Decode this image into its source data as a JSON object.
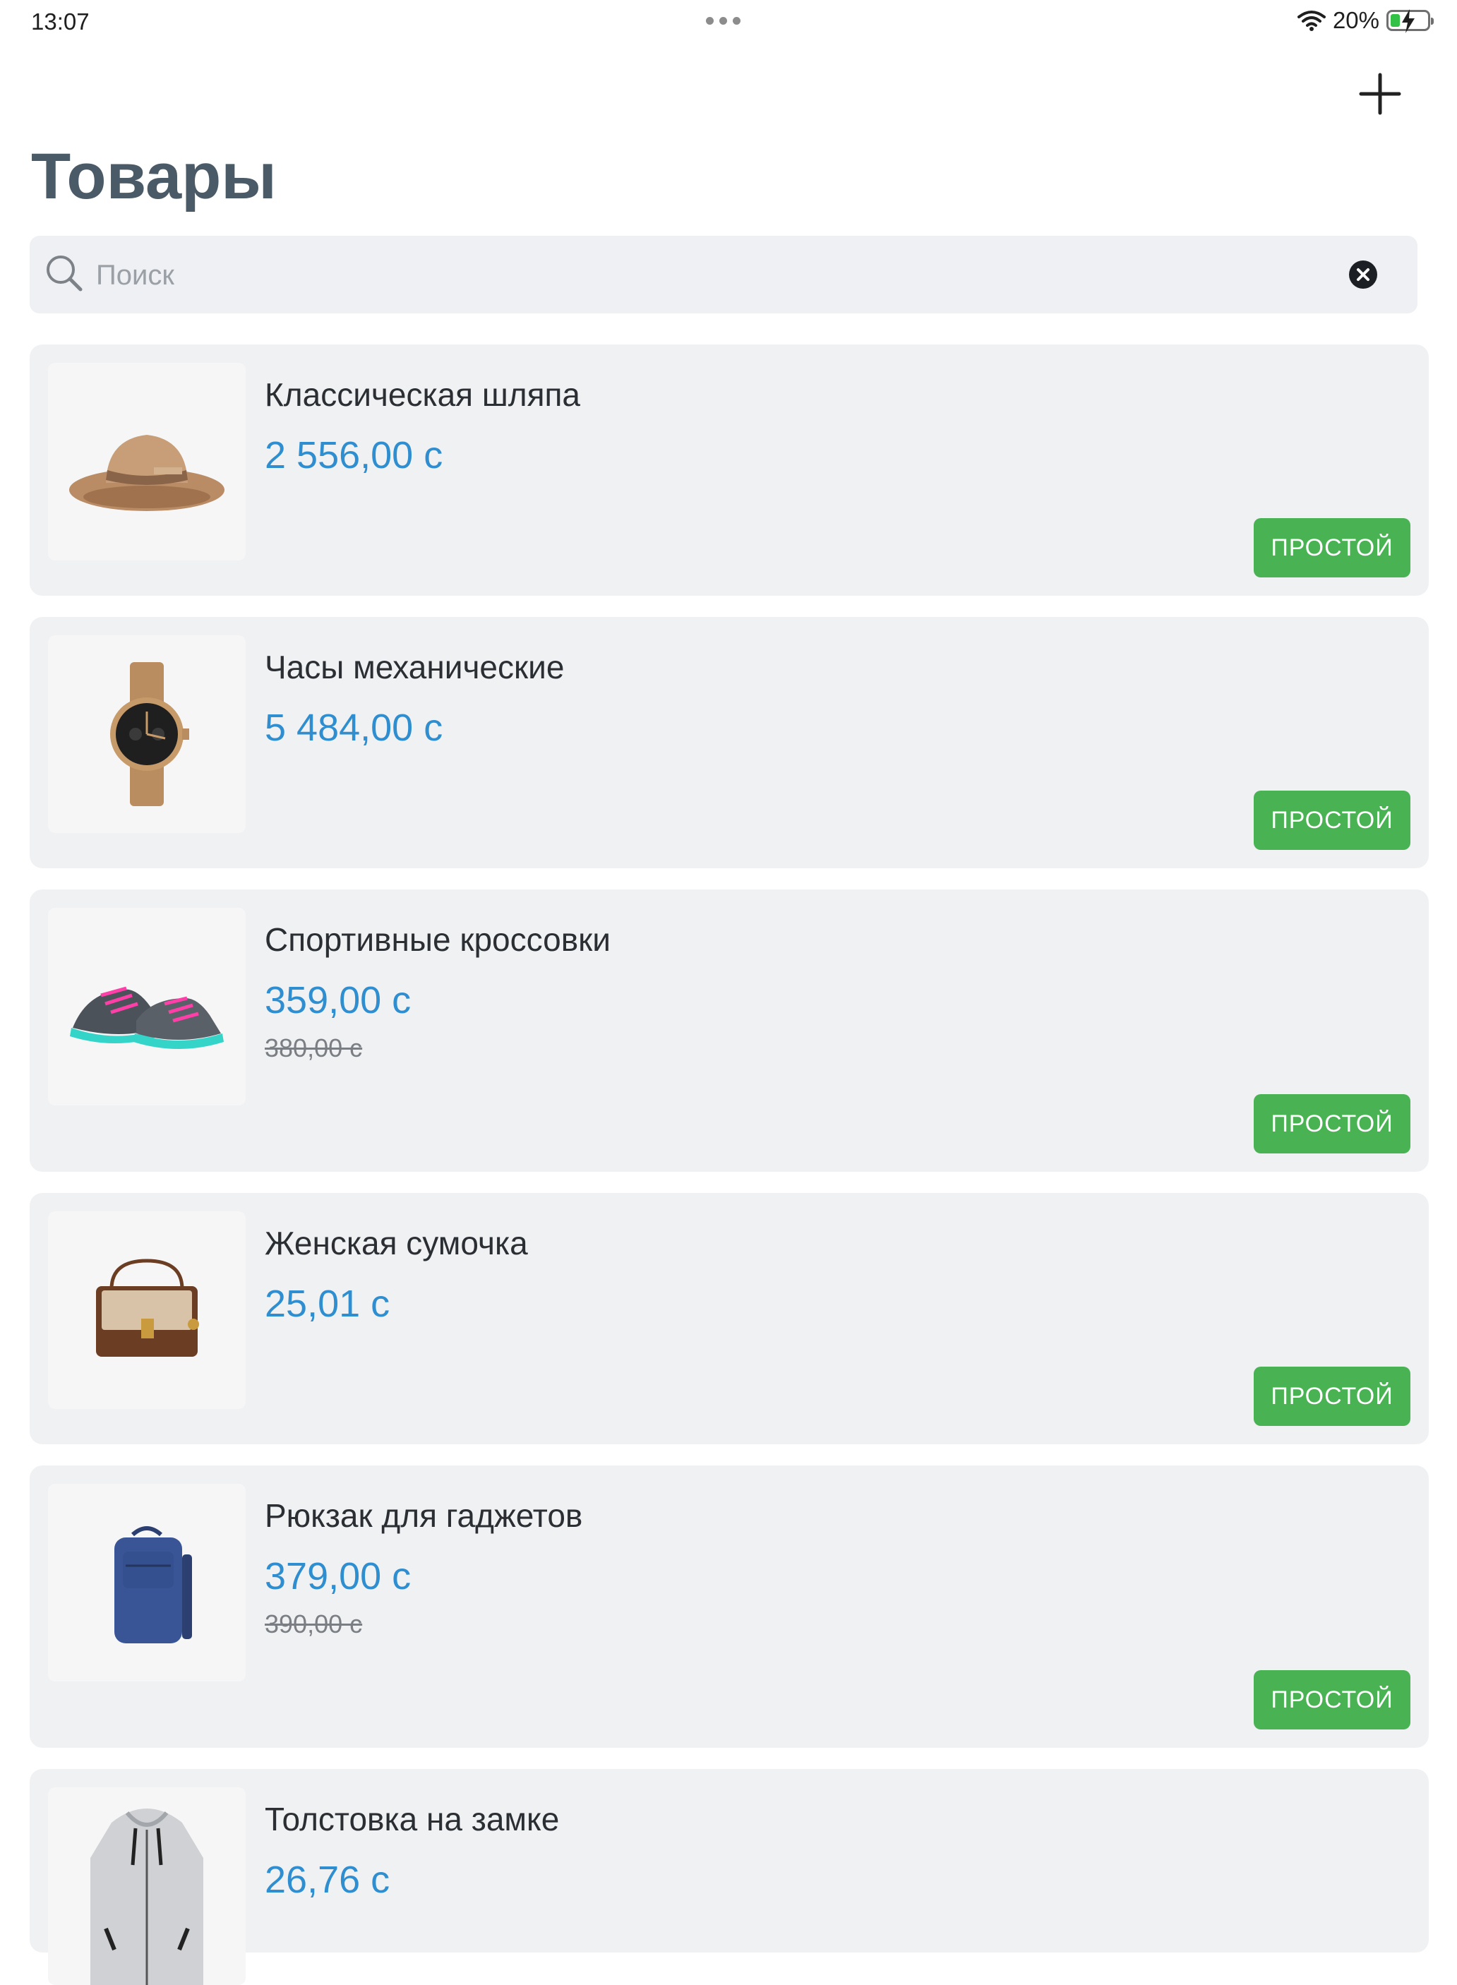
{
  "status_bar": {
    "time": "13:07",
    "battery_percent": "20%",
    "battery_level": 0.2,
    "icons": [
      "multitask-dots-icon",
      "wifi-icon",
      "battery-charging-icon"
    ]
  },
  "header": {
    "add_icon": "plus-icon",
    "title": "Товары"
  },
  "search": {
    "placeholder": "Поиск",
    "value": "",
    "icon": "search-icon",
    "clear_icon": "clear-icon"
  },
  "colors": {
    "price": "#2f8ed0",
    "badge": "#49b253",
    "card_bg": "#f0f1f3",
    "title": "#4a5a66"
  },
  "products": [
    {
      "name": "Классическая шляпа",
      "price": "2 556,00 с",
      "old_price": "",
      "badge": "ПРОСТОЙ",
      "image": "hat-image"
    },
    {
      "name": "Часы механические",
      "price": "5 484,00 с",
      "old_price": "",
      "badge": "ПРОСТОЙ",
      "image": "watch-image"
    },
    {
      "name": "Спортивные кроссовки",
      "price": "359,00 с",
      "old_price": "380,00 с",
      "badge": "ПРОСТОЙ",
      "image": "sneakers-image"
    },
    {
      "name": "Женская сумочка",
      "price": "25,01 с",
      "old_price": "",
      "badge": "ПРОСТОЙ",
      "image": "handbag-image"
    },
    {
      "name": "Рюкзак для гаджетов",
      "price": "379,00 с",
      "old_price": "390,00 с",
      "badge": "ПРОСТОЙ",
      "image": "backpack-image"
    },
    {
      "name": "Толстовка на замке",
      "price": "26,76 с",
      "old_price": "",
      "badge": "",
      "image": "hoodie-image"
    }
  ]
}
